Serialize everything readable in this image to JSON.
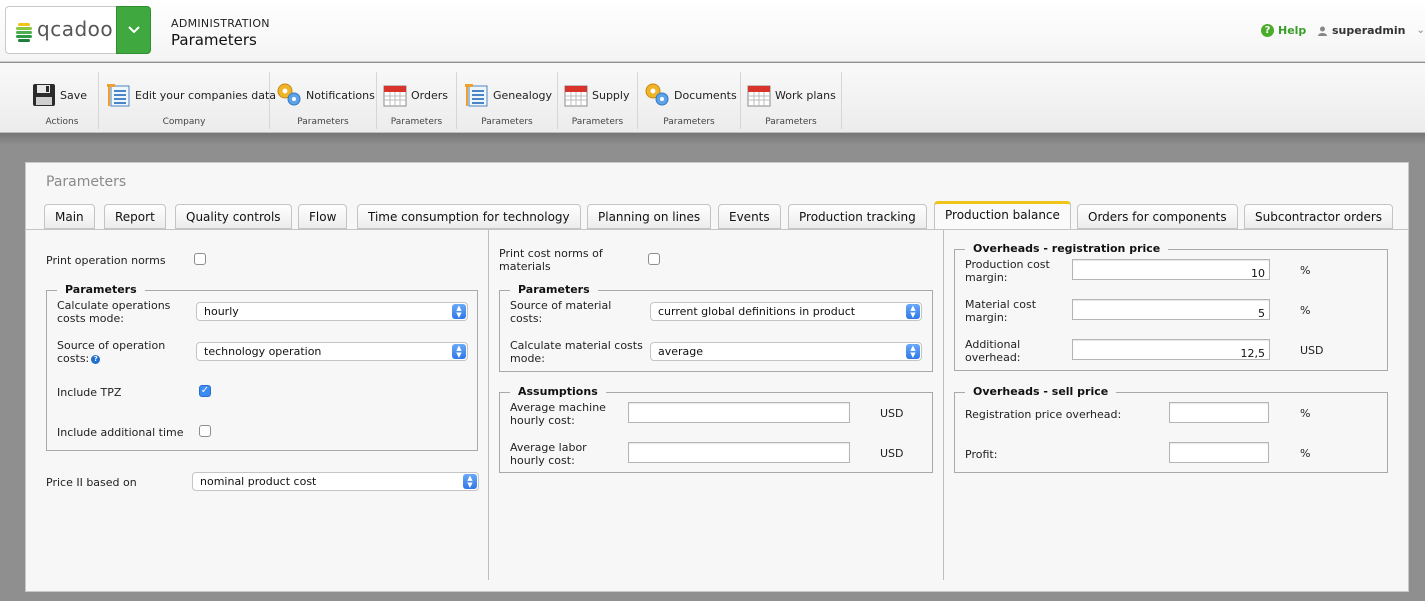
{
  "header": {
    "logo_text": "qcadoo",
    "breadcrumb_top": "ADMINISTRATION",
    "page_title": "Parameters",
    "help_label": "Help",
    "user_name": "superadmin"
  },
  "ribbon": {
    "groups": [
      {
        "label": "Actions",
        "button": "Save",
        "icon": "save-icon"
      },
      {
        "label": "Company",
        "button": "Edit your companies data",
        "icon": "list-icon"
      },
      {
        "label": "Parameters",
        "button": "Notifications",
        "icon": "gears-icon"
      },
      {
        "label": "Parameters",
        "button": "Orders",
        "icon": "calendar-icon"
      },
      {
        "label": "Parameters",
        "button": "Genealogy",
        "icon": "list-icon"
      },
      {
        "label": "Parameters",
        "button": "Supply",
        "icon": "calendar-icon"
      },
      {
        "label": "Parameters",
        "button": "Documents",
        "icon": "gears-icon"
      },
      {
        "label": "Parameters",
        "button": "Work plans",
        "icon": "calendar-icon"
      }
    ]
  },
  "panel": {
    "title": "Parameters",
    "tabs": [
      "Main",
      "Report",
      "Quality controls",
      "Flow",
      "Time consumption for technology",
      "Planning on lines",
      "Events",
      "Production tracking",
      "Production balance",
      "Orders for components",
      "Subcontractor orders"
    ],
    "active_tab": "Production balance"
  },
  "left": {
    "print_operation_norms": "Print operation norms",
    "parameters_legend": "Parameters",
    "calc_mode_label_1": "Calculate operations",
    "calc_mode_label_2": "costs mode:",
    "calc_mode_value": "hourly",
    "source_op_label_1": "Source of operation",
    "source_op_label_2": "costs:",
    "source_op_value": "technology operation",
    "include_tpz": "Include TPZ",
    "include_tpz_checked": true,
    "include_additional_time": "Include additional time",
    "price_ii_label": "Price II based on",
    "price_ii_value": "nominal product cost"
  },
  "middle": {
    "print_cost_norms_1": "Print cost norms of",
    "print_cost_norms_2": "materials",
    "parameters_legend": "Parameters",
    "source_mat_label_1": "Source of material",
    "source_mat_label_2": "costs:",
    "source_mat_value": "current global definitions in product",
    "calc_mat_label_1": "Calculate material costs",
    "calc_mat_label_2": "mode:",
    "calc_mat_value": "average",
    "assumptions_legend": "Assumptions",
    "avg_machine_1": "Average machine",
    "avg_machine_2": "hourly cost:",
    "avg_machine_value": "",
    "avg_machine_unit": "USD",
    "avg_labor_1": "Average labor",
    "avg_labor_2": "hourly cost:",
    "avg_labor_value": "",
    "avg_labor_unit": "USD"
  },
  "right": {
    "overheads_reg_legend": "Overheads - registration price",
    "prod_margin_1": "Production cost",
    "prod_margin_2": "margin:",
    "prod_margin_value": "10",
    "prod_margin_unit": "%",
    "mat_margin_1": "Material cost",
    "mat_margin_2": "margin:",
    "mat_margin_value": "5",
    "mat_margin_unit": "%",
    "add_overhead_1": "Additional",
    "add_overhead_2": "overhead:",
    "add_overhead_value": "12,5",
    "add_overhead_unit": "USD",
    "overheads_sell_legend": "Overheads - sell price",
    "reg_price_overhead": "Registration price overhead:",
    "reg_price_overhead_value": "",
    "reg_price_overhead_unit": "%",
    "profit": "Profit:",
    "profit_value": "",
    "profit_unit": "%"
  },
  "colors": {
    "accent_green": "#3fa83f",
    "active_tab_marker": "#f0c419",
    "checkbox_blue": "#3c8cf3"
  }
}
